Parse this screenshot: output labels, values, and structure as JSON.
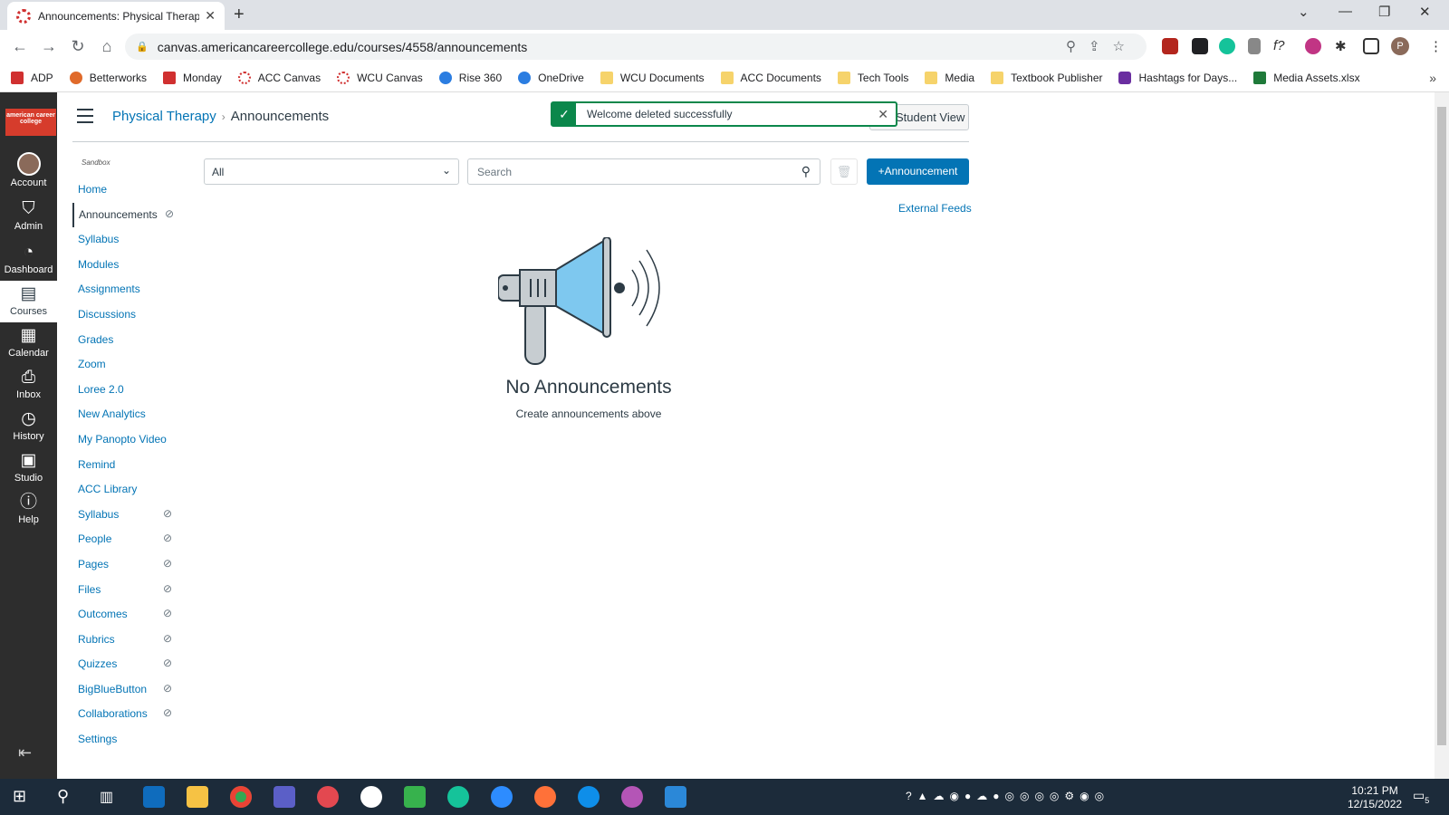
{
  "browser": {
    "tab_title": "Announcements: Physical Therap",
    "url": "canvas.americancareercollege.edu/courses/4558/announcements",
    "profile_initial": "P",
    "bookmarks": [
      "ADP",
      "Betterworks",
      "Monday",
      "ACC Canvas",
      "WCU Canvas",
      "Rise 360",
      "OneDrive",
      "WCU Documents",
      "ACC Documents",
      "Tech Tools",
      "Media",
      "Textbook Publisher",
      "Hashtags for Days...",
      "Media Assets.xlsx"
    ]
  },
  "global_nav": {
    "logo_text": "american career college",
    "items": [
      {
        "label": "Account",
        "icon": "avatar"
      },
      {
        "label": "Admin",
        "icon": "shield-icon"
      },
      {
        "label": "Dashboard",
        "icon": "dashboard-icon"
      },
      {
        "label": "Courses",
        "icon": "book-icon"
      },
      {
        "label": "Calendar",
        "icon": "calendar-icon"
      },
      {
        "label": "Inbox",
        "icon": "inbox-icon"
      },
      {
        "label": "History",
        "icon": "clock-icon"
      },
      {
        "label": "Studio",
        "icon": "studio-icon"
      },
      {
        "label": "Help",
        "icon": "help-icon"
      }
    ],
    "active": "Courses"
  },
  "header": {
    "course": "Physical Therapy",
    "page": "Announcements",
    "student_view": "Student View"
  },
  "toast": {
    "message": "Welcome deleted successfully"
  },
  "course_nav": {
    "term": "Sandbox",
    "items": [
      {
        "label": "Home",
        "hidden": false
      },
      {
        "label": "Announcements",
        "hidden": true,
        "active": true
      },
      {
        "label": "Syllabus",
        "hidden": false
      },
      {
        "label": "Modules",
        "hidden": false
      },
      {
        "label": "Assignments",
        "hidden": false
      },
      {
        "label": "Discussions",
        "hidden": false
      },
      {
        "label": "Grades",
        "hidden": false
      },
      {
        "label": "Zoom",
        "hidden": false
      },
      {
        "label": "Loree 2.0",
        "hidden": false
      },
      {
        "label": "New Analytics",
        "hidden": false
      },
      {
        "label": "My Panopto Video",
        "hidden": false
      },
      {
        "label": "Remind",
        "hidden": false
      },
      {
        "label": "ACC Library",
        "hidden": false
      },
      {
        "label": "Syllabus",
        "hidden": true
      },
      {
        "label": "People",
        "hidden": true
      },
      {
        "label": "Pages",
        "hidden": true
      },
      {
        "label": "Files",
        "hidden": true
      },
      {
        "label": "Outcomes",
        "hidden": true
      },
      {
        "label": "Rubrics",
        "hidden": true
      },
      {
        "label": "Quizzes",
        "hidden": true
      },
      {
        "label": "BigBlueButton",
        "hidden": true
      },
      {
        "label": "Collaborations",
        "hidden": true
      },
      {
        "label": "Settings",
        "hidden": false
      }
    ]
  },
  "main": {
    "filter_value": "All",
    "search_placeholder": "Search",
    "add_button": "+Announcement",
    "external_feeds": "External Feeds",
    "empty_title": "No Announcements",
    "empty_subtitle": "Create announcements above"
  },
  "taskbar": {
    "time": "10:21 PM",
    "date": "12/15/2022",
    "notification_count": "5"
  },
  "colors": {
    "canvas_blue": "#0374b5",
    "nav_dark": "#2d2d2d",
    "success_green": "#0b874b",
    "brand_red": "#d63c2c"
  }
}
